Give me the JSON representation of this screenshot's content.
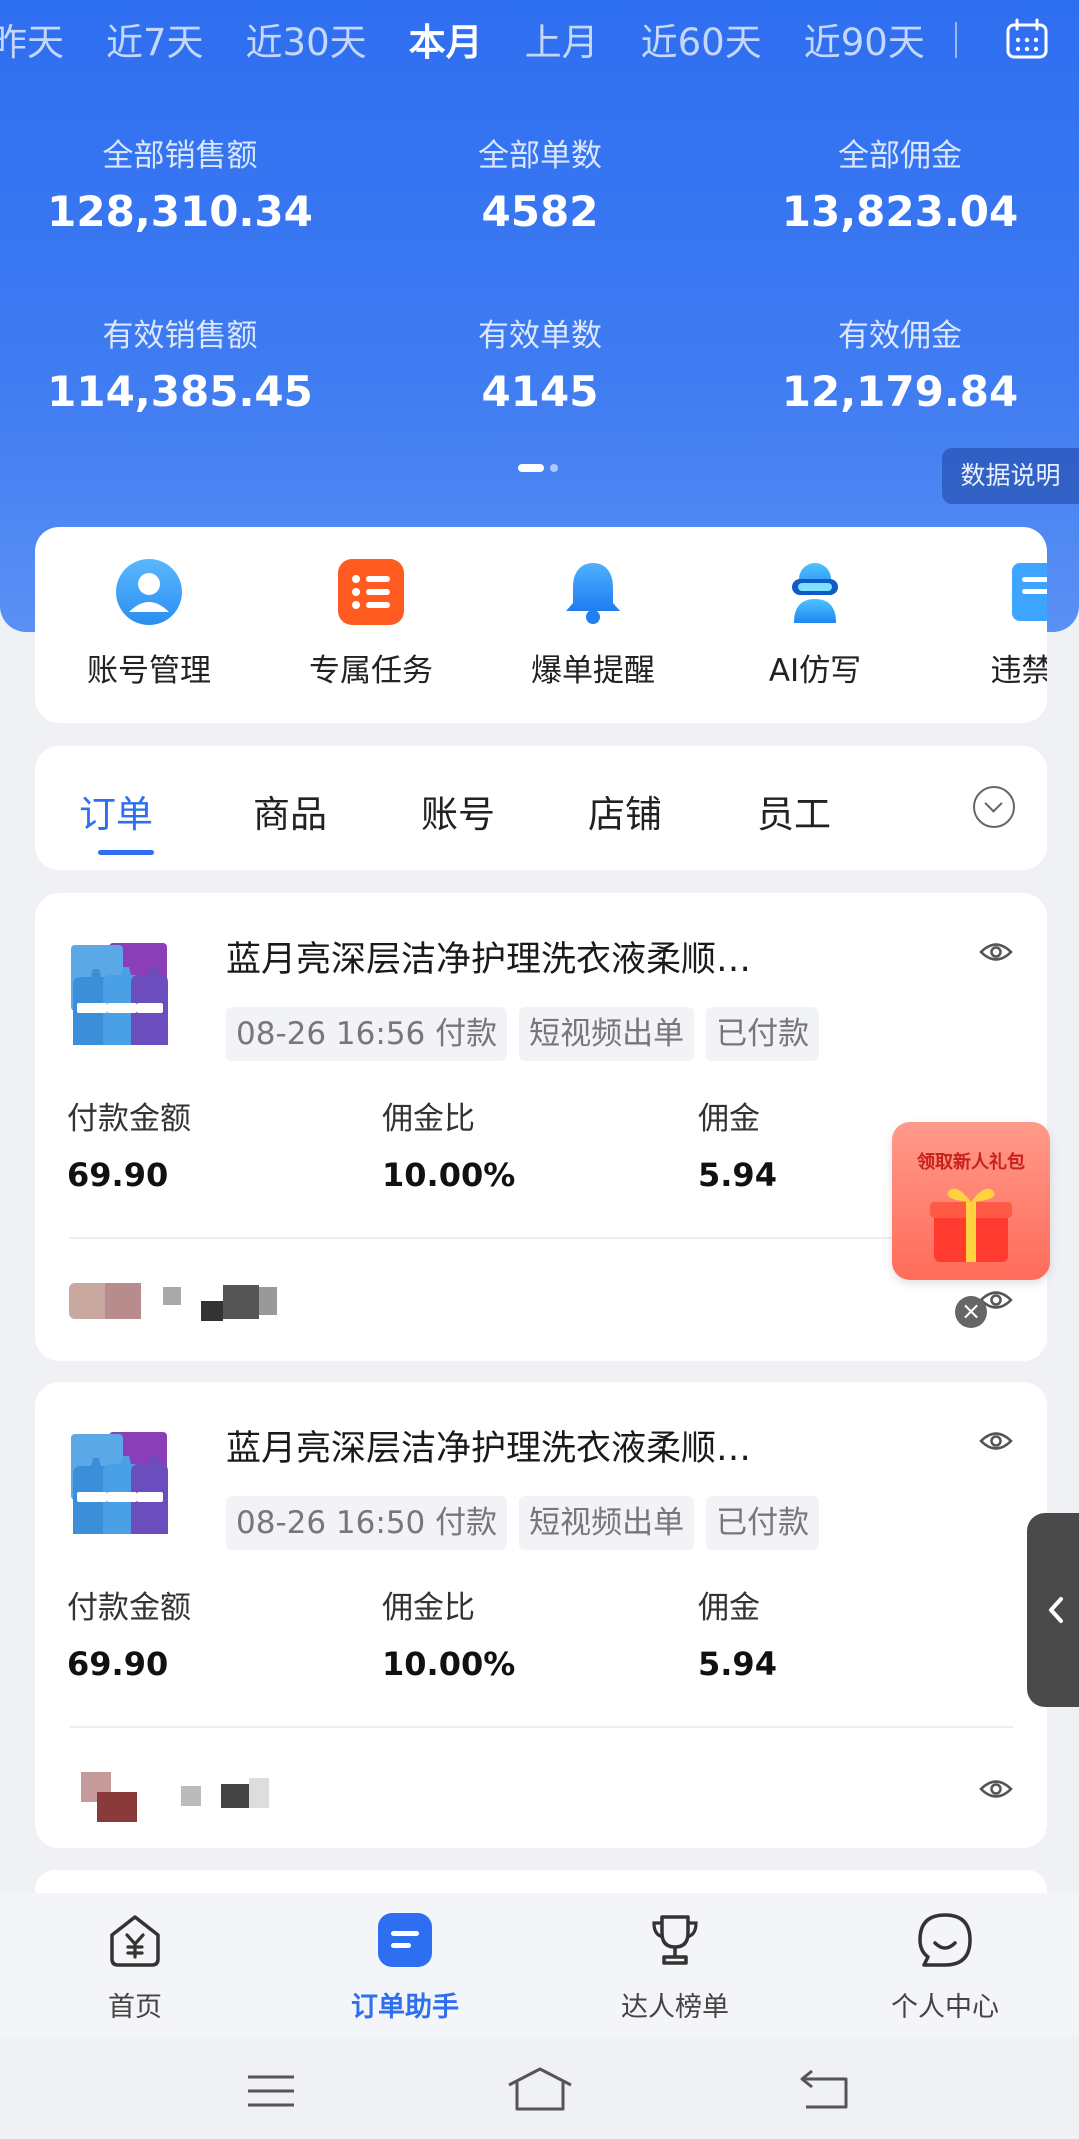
{
  "date_tabs": [
    "昨天",
    "近7天",
    "近30天",
    "本月",
    "上月",
    "近60天",
    "近90天"
  ],
  "active_date_tab": "本月",
  "stats": [
    {
      "label": "全部销售额",
      "value": "128,310.34"
    },
    {
      "label": "全部单数",
      "value": "4582"
    },
    {
      "label": "全部佣金",
      "value": "13,823.04"
    },
    {
      "label": "有效销售额",
      "value": "114,385.45"
    },
    {
      "label": "有效单数",
      "value": "4145"
    },
    {
      "label": "有效佣金",
      "value": "12,179.84"
    }
  ],
  "data_explain_label": "数据说明",
  "quick_actions": [
    {
      "label": "账号管理",
      "icon": "user-circle-icon"
    },
    {
      "label": "专属任务",
      "icon": "task-list-icon"
    },
    {
      "label": "爆单提醒",
      "icon": "bell-icon"
    },
    {
      "label": "AI仿写",
      "icon": "ai-robot-icon"
    },
    {
      "label": "违禁词",
      "icon": "document-icon"
    }
  ],
  "order_tabs": [
    "订单",
    "商品",
    "账号",
    "店铺",
    "员工"
  ],
  "active_order_tab": "订单",
  "orders": [
    {
      "title": "蓝月亮深层洁净护理洗衣液柔顺…",
      "tags": [
        "08-26 16:56 付款",
        "短视频出单",
        "已付款"
      ],
      "metrics": [
        {
          "label": "付款金额",
          "value": "69.90"
        },
        {
          "label": "佣金比",
          "value": "10.00%"
        },
        {
          "label": "佣金",
          "value": "5.94"
        }
      ]
    },
    {
      "title": "蓝月亮深层洁净护理洗衣液柔顺…",
      "tags": [
        "08-26 16:50 付款",
        "短视频出单",
        "已付款"
      ],
      "metrics": [
        {
          "label": "付款金额",
          "value": "69.90"
        },
        {
          "label": "佣金比",
          "value": "10.00%"
        },
        {
          "label": "佣金",
          "value": "5.94"
        }
      ]
    }
  ],
  "gift_popup_text": "领取新人礼包",
  "gift_close": "×",
  "bottom_nav": [
    {
      "label": "首页",
      "icon": "yuan-home-icon"
    },
    {
      "label": "订单助手",
      "icon": "order-assistant-icon"
    },
    {
      "label": "达人榜单",
      "icon": "trophy-icon"
    },
    {
      "label": "个人中心",
      "icon": "chat-smile-icon"
    }
  ],
  "active_bottom_nav": "订单助手",
  "colors": {
    "primary": "#2e6ef0",
    "task_orange": "#ff5a1f",
    "hero_top": "#2e6ef0"
  }
}
